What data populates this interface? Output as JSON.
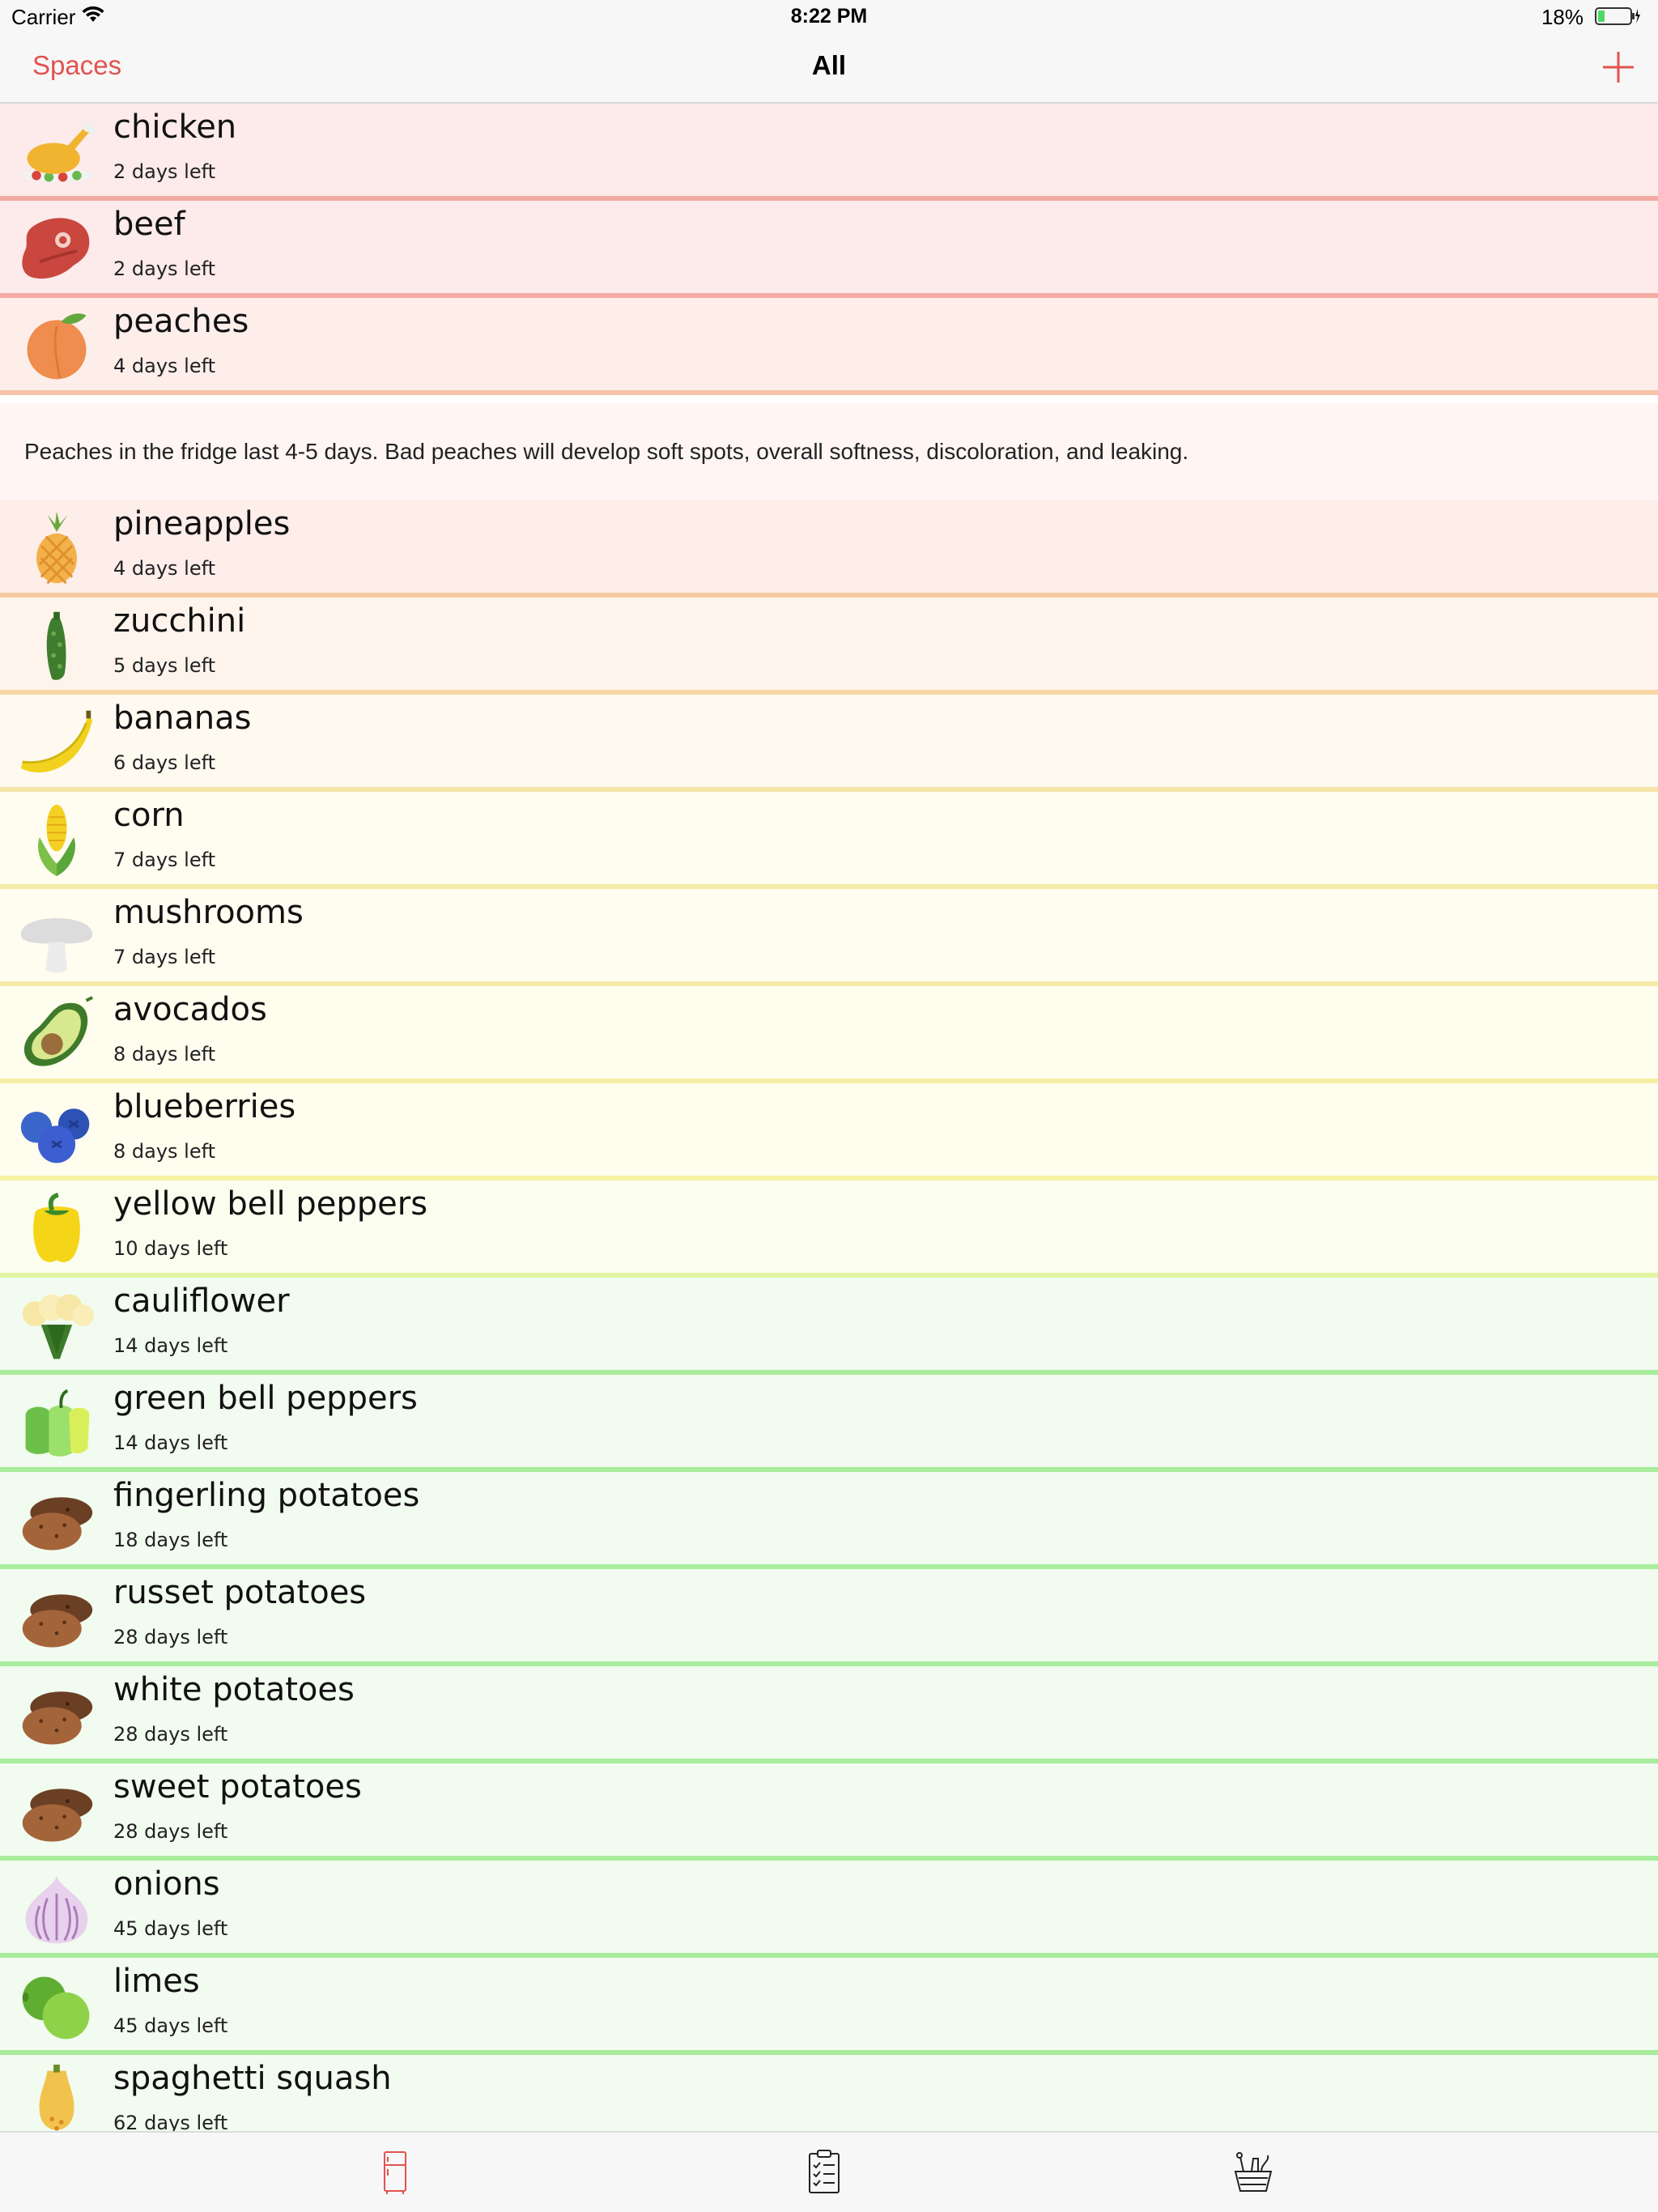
{
  "status_bar": {
    "carrier": "Carrier",
    "time": "8:22 PM",
    "battery": "18%"
  },
  "nav": {
    "left_button": "Spaces",
    "title": "All",
    "add_icon": "plus-icon",
    "accent_color": "#e2534f"
  },
  "items": [
    {
      "name": "chicken",
      "days": "2 days left",
      "icon": "chicken-icon",
      "bg": "#fdeaea",
      "line": "#f3aaa2"
    },
    {
      "name": "beef",
      "days": "2 days left",
      "icon": "steak-icon",
      "bg": "#fdeaea",
      "line": "#f3aaa2"
    },
    {
      "name": "peaches",
      "days": "4 days left",
      "icon": "peach-icon",
      "bg": "#fdeeea",
      "line": "#f6c2a8"
    },
    {
      "name": "pineapples",
      "days": "4 days left",
      "icon": "pineapple-icon",
      "bg": "#fdeeea",
      "line": "#f6caa0"
    },
    {
      "name": "zucchini",
      "days": "5 days left",
      "icon": "zucchini-icon",
      "bg": "#fef4ec",
      "line": "#f7d7a6"
    },
    {
      "name": "bananas",
      "days": "6 days left",
      "icon": "banana-icon",
      "bg": "#fefaf0",
      "line": "#f6e4a7"
    },
    {
      "name": "corn",
      "days": "7 days left",
      "icon": "corn-icon",
      "bg": "#fffcf0",
      "line": "#f5eba8"
    },
    {
      "name": "mushrooms",
      "days": "7 days left",
      "icon": "mushroom-icon",
      "bg": "#fffcf0",
      "line": "#f5eba8"
    },
    {
      "name": "avocados",
      "days": "8 days left",
      "icon": "avocado-icon",
      "bg": "#fffdee",
      "line": "#f6f0a6"
    },
    {
      "name": "blueberries",
      "days": "8 days left",
      "icon": "blueberries-icon",
      "bg": "#fffdee",
      "line": "#f6f4a4"
    },
    {
      "name": "yellow bell peppers",
      "days": "10 days left",
      "icon": "yellow-pepper-icon",
      "bg": "#fbfdee",
      "line": "#e2f4a4"
    },
    {
      "name": "cauliflower",
      "days": "14 days left",
      "icon": "cauliflower-icon",
      "bg": "#f1fbef",
      "line": "#a8ec9c"
    },
    {
      "name": "green bell peppers",
      "days": "14 days left",
      "icon": "green-pepper-icon",
      "bg": "#f1fbef",
      "line": "#a8ec9c"
    },
    {
      "name": "fingerling potatoes",
      "days": "18 days left",
      "icon": "potato-icon",
      "bg": "#f1fbef",
      "line": "#a8ec9c"
    },
    {
      "name": "russet potatoes",
      "days": "28 days left",
      "icon": "potato-icon",
      "bg": "#f1fbef",
      "line": "#a8ec9c"
    },
    {
      "name": "white potatoes",
      "days": "28 days left",
      "icon": "potato-icon",
      "bg": "#f1fbef",
      "line": "#a8ec9c"
    },
    {
      "name": "sweet potatoes",
      "days": "28 days left",
      "icon": "potato-icon",
      "bg": "#f1fbef",
      "line": "#a8ec9c"
    },
    {
      "name": "onions",
      "days": "45 days left",
      "icon": "onion-icon",
      "bg": "#f1fbef",
      "line": "#a8ec9c"
    },
    {
      "name": "limes",
      "days": "45 days left",
      "icon": "lime-icon",
      "bg": "#f1fbef",
      "line": "#a8ec9c"
    },
    {
      "name": "spaghetti squash",
      "days": "62 days left",
      "icon": "squash-icon",
      "bg": "#f1fbef",
      "line": "#a8ec9c"
    }
  ],
  "note": {
    "text": "Peaches in the fridge last 4-5 days.  Bad peaches will develop soft spots, overall softness, discoloration, and leaking."
  },
  "tabs": [
    {
      "icon": "fridge-icon",
      "selected": true
    },
    {
      "icon": "checklist-icon",
      "selected": false
    },
    {
      "icon": "basket-icon",
      "selected": false
    }
  ]
}
